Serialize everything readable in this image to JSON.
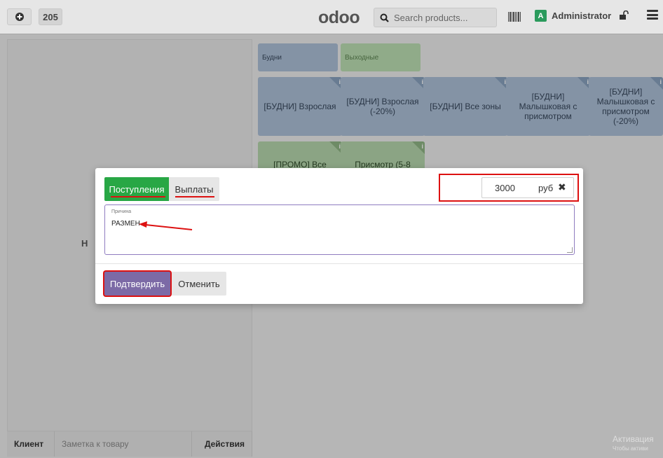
{
  "topbar": {
    "order_number": "205",
    "logo": "odoo",
    "search_placeholder": "Search products...",
    "user_initial": "A",
    "user_name": "Administrator"
  },
  "left_panel": {
    "partial_text": "Н",
    "footer": {
      "client": "Клиент",
      "note": "Заметка к товару",
      "actions": "Действия"
    }
  },
  "categories": [
    "Будни",
    "Выходные"
  ],
  "products": [
    {
      "name": "[БУДНИ] Взрослая",
      "group": "blue"
    },
    {
      "name": "[БУДНИ] Взрослая (-20%)",
      "group": "blue"
    },
    {
      "name": "[БУДНИ] Все зоны",
      "group": "blue"
    },
    {
      "name": "[БУДНИ] Малышковая с присмотром",
      "group": "blue"
    },
    {
      "name": "[БУДНИ] Малышковая с присмотром (-20%)",
      "group": "blue"
    },
    {
      "name": "[ПРОМО] Все",
      "group": "green"
    },
    {
      "name": "Присмотр (5-8",
      "group": "green"
    }
  ],
  "modal": {
    "tab_in": "Поступления",
    "tab_out": "Выплаты",
    "amount": "3000",
    "currency": "руб",
    "reason_label": "Причина",
    "reason_value": "РАЗМЕН",
    "confirm": "Подтвердить",
    "cancel": "Отменить"
  },
  "watermark": {
    "line1": "Активация",
    "line2": "Чтобы активи"
  },
  "colors": {
    "accent_green": "#28a745",
    "primary_purple": "#7c6aa6",
    "annotation_red": "#dd1111"
  }
}
